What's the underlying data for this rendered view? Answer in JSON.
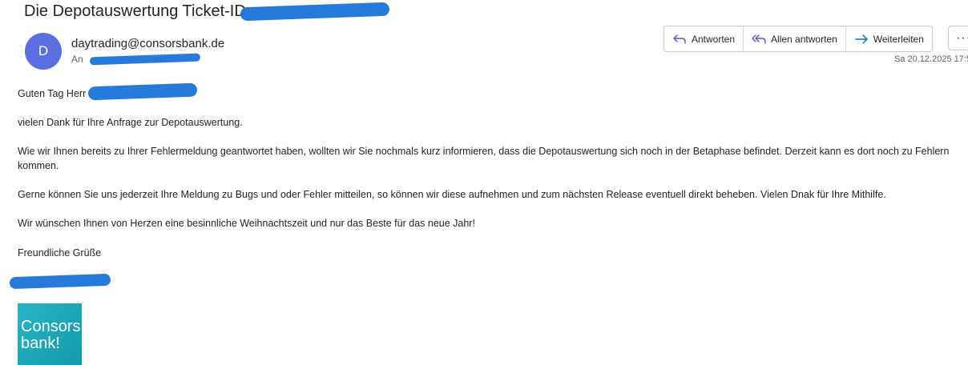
{
  "header": {
    "subject": "Die Depotauswertung Ticket-ID:",
    "avatar_initial": "D",
    "sender": "daytrading@consorsbank.de",
    "to_label": "An",
    "date": "Sa 20.12.2025 17:5"
  },
  "toolbar": {
    "reply_label": "Antworten",
    "reply_all_label": "Allen antworten",
    "forward_label": "Weiterleiten",
    "more_label": "···"
  },
  "body": {
    "greeting": "Guten Tag Herr",
    "para1": "vielen Dank für Ihre Anfrage zur Depotauswertung.",
    "para2": "Wie wir Ihnen bereits zu Ihrer Fehlermeldung geantwortet haben, wollten wir Sie nochmals kurz informieren, dass die Depotauswertung sich noch in der Betaphase befindet. Derzeit kann es dort noch zu Fehlern kommen.",
    "para3": "Gerne können Sie uns jederzeit Ihre Meldung zu Bugs und oder Fehler mitteilen, so können wir diese aufnehmen und zum nächsten Release eventuell direkt beheben. Vielen Dnak für Ihre Mithilfe.",
    "para4": "Wir wünschen Ihnen von Herzen eine besinnliche Weihnachtszeit und nur das Beste für das neue Jahr!",
    "closing": "Freundliche Grüße"
  },
  "logo": {
    "line1": "Consors",
    "line2": "bank!"
  },
  "colors": {
    "redaction": "#1a73d9",
    "avatar": "#5b6fe0",
    "reply_icon": "#6b4fbb",
    "forward_icon": "#0f6cbd",
    "logo": "#1aa6b7"
  }
}
